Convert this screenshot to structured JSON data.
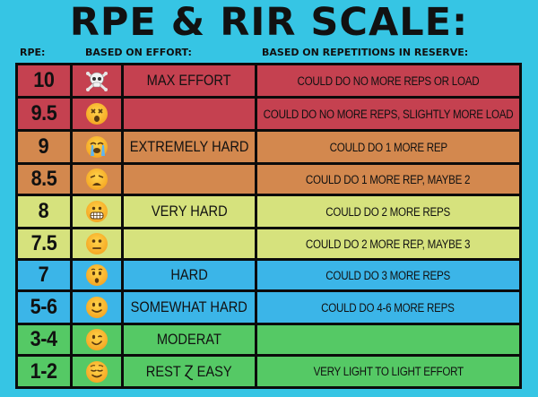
{
  "title": "RPE & RIR SCALE:",
  "headers": {
    "rpe": "RPE:",
    "effort": "BASED ON EFFORT:",
    "reps": "BASED ON REPETITIONS IN RESERVE:"
  },
  "colors": {
    "background": "#36c5e4",
    "red": "#c54150",
    "orange": "#d3884e",
    "yellow": "#d6e27d",
    "blue": "#3bb5e8",
    "green": "#55c965"
  },
  "rows": [
    {
      "rpe": "10",
      "icon": "skull-crossbones-icon",
      "effort": "MAX EFFORT",
      "reps": "COULD DO NO MORE REPS OR LOAD",
      "color": "#c54150"
    },
    {
      "rpe": "9.5",
      "icon": "dizzy-face-icon",
      "effort": "",
      "reps": "COULD DO NO MORE REPS, SLIGHTLY MORE LOAD",
      "color": "#c54150"
    },
    {
      "rpe": "9",
      "icon": "loudly-crying-face-icon",
      "effort": "EXTREMELY HARD",
      "reps": "COULD DO 1 MORE REP",
      "color": "#d3884e"
    },
    {
      "rpe": "8.5",
      "icon": "weary-face-icon",
      "effort": "",
      "reps": "COULD DO 1 MORE REP, MAYBE 2",
      "color": "#d3884e"
    },
    {
      "rpe": "8",
      "icon": "grimacing-face-icon",
      "effort": "VERY HARD",
      "reps": "COULD DO 2 MORE REPS",
      "color": "#d6e27d"
    },
    {
      "rpe": "7.5",
      "icon": "neutral-face-icon",
      "effort": "",
      "reps": "COULD DO 2 MORE REP, MAYBE 3",
      "color": "#d6e27d"
    },
    {
      "rpe": "7",
      "icon": "hushed-face-icon",
      "effort": "HARD",
      "reps": "COULD DO 3 MORE REPS",
      "color": "#3bb5e8"
    },
    {
      "rpe": "5-6",
      "icon": "slightly-smiling-face-icon",
      "effort": "SOMEWHAT HARD",
      "reps": "COULD DO 4-6 MORE REPS",
      "color": "#3bb5e8"
    },
    {
      "rpe": "3-4",
      "icon": "winking-face-icon",
      "effort": "MODERAT",
      "reps": "",
      "color": "#55c965"
    },
    {
      "rpe": "1-2",
      "icon": "relieved-face-icon",
      "effort": "REST Ɀ EASY",
      "reps": "VERY LIGHT TO LIGHT EFFORT",
      "color": "#55c965"
    }
  ]
}
